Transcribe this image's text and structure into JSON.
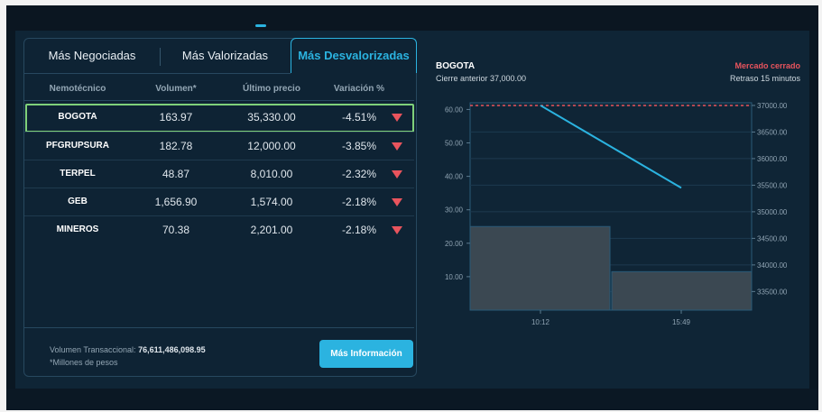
{
  "tabs": [
    {
      "label": "Más Negociadas"
    },
    {
      "label": "Más Valorizadas"
    },
    {
      "label": "Más Desvalorizadas"
    }
  ],
  "table": {
    "columns": [
      "Nemotécnico",
      "Volumen*",
      "Último precio",
      "Variación %"
    ],
    "rows": [
      {
        "symbol": "BOGOTA",
        "volume": "163.97",
        "price": "35,330.00",
        "change": "-4.51%"
      },
      {
        "symbol": "PFGRUPSURA",
        "volume": "182.78",
        "price": "12,000.00",
        "change": "-3.85%"
      },
      {
        "symbol": "TERPEL",
        "volume": "48.87",
        "price": "8,010.00",
        "change": "-2.32%"
      },
      {
        "symbol": "GEB",
        "volume": "1,656.90",
        "price": "1,574.00",
        "change": "-2.18%"
      },
      {
        "symbol": "MINEROS",
        "volume": "70.38",
        "price": "2,201.00",
        "change": "-2.18%"
      }
    ]
  },
  "footer": {
    "volume_label": "Volumen Transaccional:",
    "volume_value": "76,611,486,098.95",
    "note": "*Millones de pesos",
    "button": "Más Información"
  },
  "chart_panel": {
    "title": "BOGOTA",
    "subtitle": "Cierre anterior 37,000.00",
    "status": "Mercado cerrado",
    "delay": "Retraso 15 minutos"
  },
  "colors": {
    "accent": "#2bb3e0",
    "negative": "#e9545d",
    "selected_border": "#7fd17a",
    "bar_fill": "#3b4852"
  },
  "chart_data": {
    "type": "line",
    "x_ticks": [
      "10:12",
      "15:49"
    ],
    "left_axis": {
      "ticks": [
        "60.00",
        "50.00",
        "40.00",
        "30.00",
        "20.00",
        "10.00"
      ],
      "ylim": [
        0,
        62
      ]
    },
    "right_axis": {
      "ticks": [
        "37000.00",
        "36500.00",
        "36000.00",
        "35500.00",
        "35000.00",
        "34500.00",
        "34000.00",
        "33500.00"
      ],
      "ylim": [
        33150,
        37050
      ]
    },
    "volume_bars": [
      {
        "x": "10:12",
        "value": 25
      },
      {
        "x": "15:49",
        "value": 11.5
      }
    ],
    "price_line": [
      {
        "x": "10:12",
        "value": 37000
      },
      {
        "x": "15:49",
        "value": 35450
      }
    ],
    "reference_line": {
      "value": 37000,
      "style": "dashed"
    }
  }
}
